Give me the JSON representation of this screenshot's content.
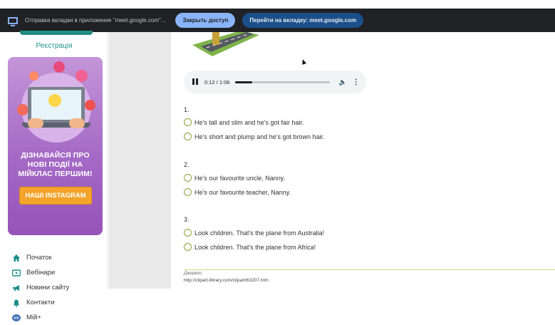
{
  "share_bar": {
    "text": "Отправка вкладки в приложение \"meet.google.com\"...",
    "stop_label": "Закрыть доступ",
    "goto_label": "Перейти на вкладку: meet.google.com"
  },
  "sidebar": {
    "register_label": "Реєстрація",
    "promo_title": "ДІЗНАВАЙСЯ ПРО НОВІ ПОДІЇ НА МІЙКЛАС ПЕРШИМ!",
    "promo_button": "НАШІ INSTAGRAM",
    "nav": [
      {
        "label": "Початок",
        "icon": "home-icon"
      },
      {
        "label": "Вебінари",
        "icon": "video-icon"
      },
      {
        "label": "Новини сайту",
        "icon": "megaphone-icon"
      },
      {
        "label": "Контакти",
        "icon": "bell-icon"
      },
      {
        "label": "Мій+",
        "icon": "profile-badge-icon"
      }
    ]
  },
  "player": {
    "time": "0:12 / 1:06",
    "progress": 0.18
  },
  "questions": [
    {
      "number": "1.",
      "options": [
        "He's tall and slim and he's got fair hair.",
        "He's short and plump and he's got brown hair."
      ]
    },
    {
      "number": "2.",
      "options": [
        "He's our favourite uncle, Nanny.",
        "He's our favourite teacher, Nanny."
      ]
    },
    {
      "number": "3.",
      "options": [
        "Look children. That's the plane from Australia!",
        "Look children. That's the plane from Africa!"
      ]
    }
  ],
  "source": {
    "label": "Джерело:",
    "url": "http://clipart-library.com/clipart/63207.htm"
  },
  "colors": {
    "accent_teal": "#1b8f8a",
    "promo_purple": "#a56ac6",
    "insta_orange": "#f4a42a",
    "radio_green": "#8aa23a"
  }
}
